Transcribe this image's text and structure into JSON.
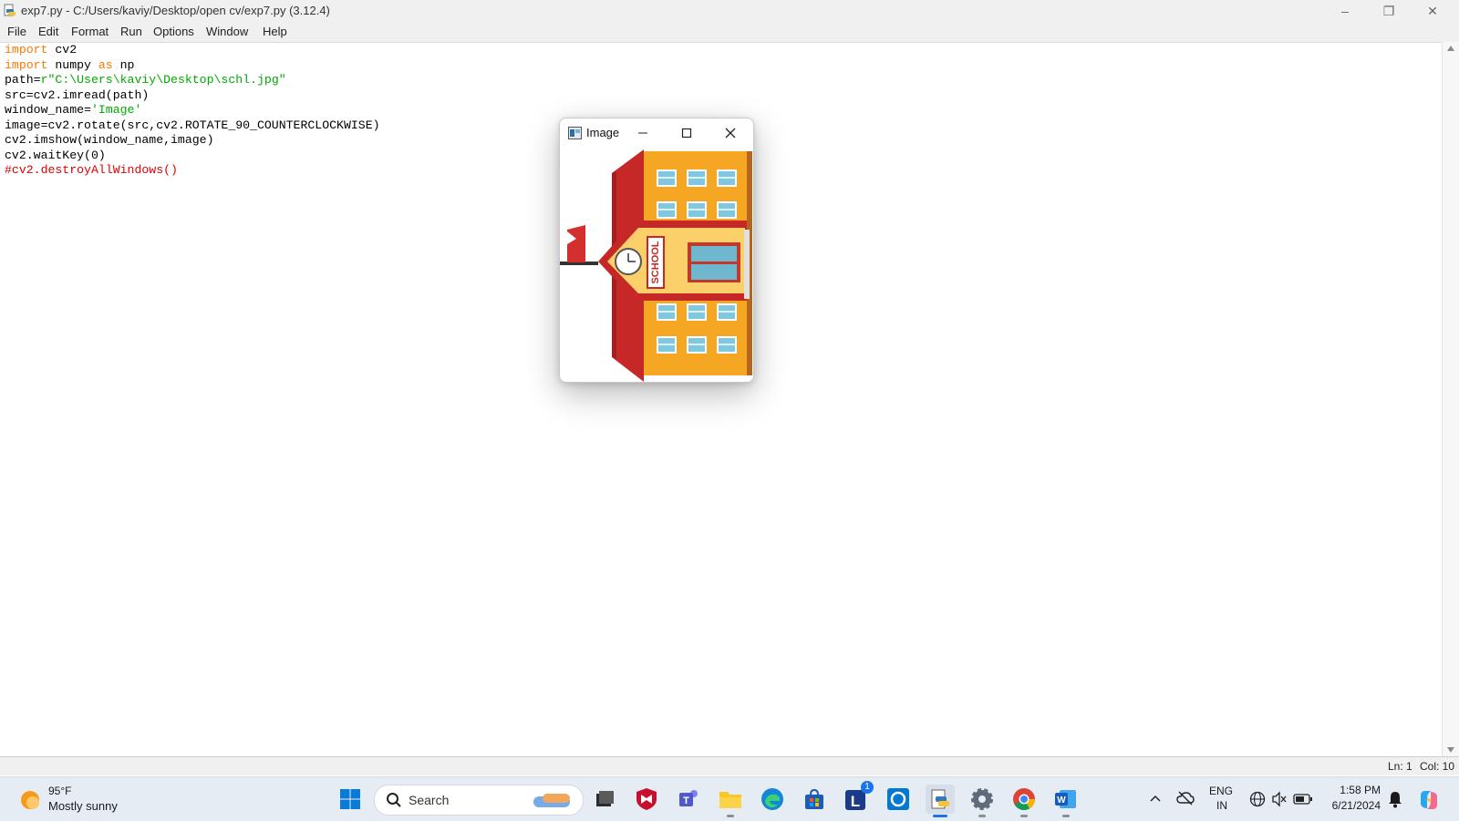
{
  "window": {
    "title": "exp7.py - C:/Users/kaviy/Desktop/open cv/exp7.py (3.12.4)",
    "minimize": "–",
    "restore": "❐",
    "close": "✕"
  },
  "menu": [
    "File",
    "Edit",
    "Format",
    "Run",
    "Options",
    "Window",
    "Help"
  ],
  "editor": {
    "lines": [
      {
        "kw": "import",
        "rest": " cv2"
      },
      {
        "kw": "import",
        "mid": " numpy ",
        "kw2": "as",
        "rest": " np"
      },
      {
        "pre": "path=",
        "str": "r\"C:\\Users\\kaviy\\Desktop\\schl.jpg\""
      },
      {
        "pre": "src=cv2.imread(path)"
      },
      {
        "pre": "window_name=",
        "str": "'Image'"
      },
      {
        "pre": "image=cv2.rotate(src,cv2.ROTATE_90_COUNTERCLOCKWISE)"
      },
      {
        "pre": "cv2.imshow(window_name,image)"
      },
      {
        "pre": "cv2.waitKey(0)"
      },
      {
        "cmt": "#cv2.destroyAllWindows()"
      }
    ]
  },
  "status": {
    "line": "Ln: 1",
    "col": "Col: 10"
  },
  "image_window": {
    "title": "Image",
    "school_label": "SCHOOL"
  },
  "taskbar": {
    "weather_temp": "95°F",
    "weather_desc": "Mostly sunny",
    "search_placeholder": "Search",
    "badge_count": "1",
    "lang_top": "ENG",
    "lang_bottom": "IN",
    "time": "1:58 PM",
    "date": "6/21/2024"
  },
  "colors": {
    "keyword": "#ff7700",
    "string": "#00aa00",
    "comment": "#dd0000",
    "school_wall": "#f5a623",
    "school_red": "#c62828"
  }
}
